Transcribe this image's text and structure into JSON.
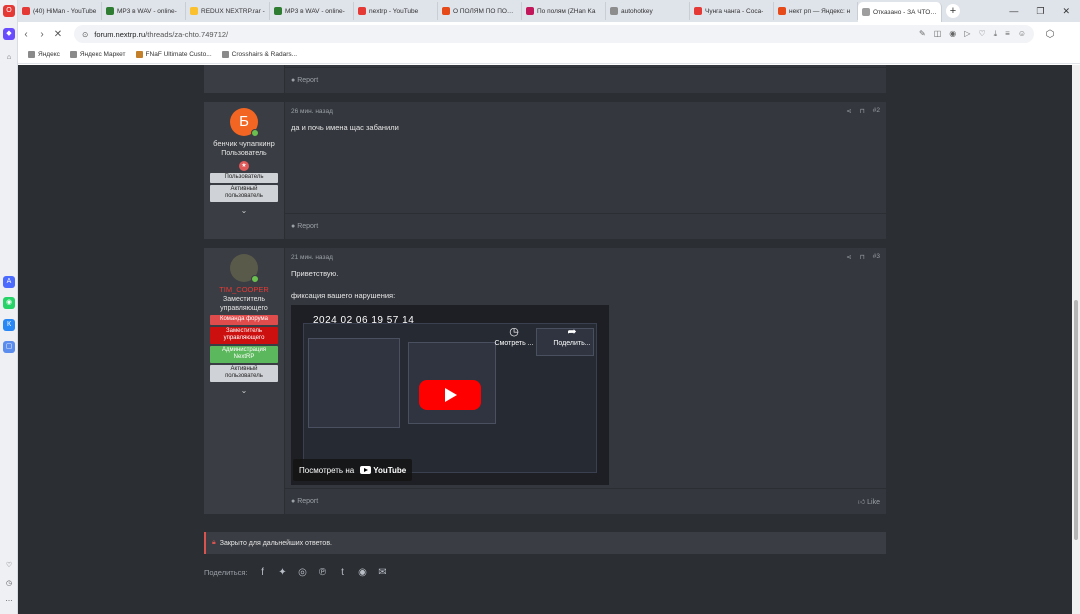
{
  "browser": {
    "tabs": [
      {
        "label": "(40) HiMan - YouTube",
        "color": "#e53935",
        "active": false
      },
      {
        "label": "MP3 в WAV - online-",
        "color": "#2e7d32",
        "active": false
      },
      {
        "label": "REDUX NEXTRP.rar -",
        "color": "#fbc02d",
        "active": false
      },
      {
        "label": "MP3 в WAV - online-",
        "color": "#2e7d32",
        "active": false
      },
      {
        "label": "nextrp - YouTube",
        "color": "#e53935",
        "active": false
      },
      {
        "label": "О ПОЛЯМ ПО ПОЛЯМ",
        "color": "#e64a19",
        "active": false
      },
      {
        "label": "По полям (ZHan Ka",
        "color": "#c2185b",
        "active": false
      },
      {
        "label": "autohotkey",
        "color": "#8d8d8d",
        "active": false
      },
      {
        "label": "Чунга чанга - Coca-",
        "color": "#e53935",
        "active": false
      },
      {
        "label": "нект рп — Яндекс: н",
        "color": "#e64a19",
        "active": false
      },
      {
        "label": "Отказано - ЗА ЧТО | NEX",
        "color": "#9e9e9e",
        "active": true
      }
    ],
    "new_tab": "+",
    "url_host": "forum.nextrp.ru",
    "url_path": "/threads/za-chto.749712/",
    "bookmarks": [
      "Яндекс",
      "Яндекс Маркет",
      "FNaF Ultimate Custo...",
      "Crosshairs & Radars..."
    ]
  },
  "posts": [
    {
      "footer_report": "Report"
    },
    {
      "avatar_letter": "Б",
      "avatar_color": "#f26522",
      "username": "бенчик чупапкинр",
      "user_title": "Пользователь",
      "banners": [
        "Пользователь",
        "Активный пользователь"
      ],
      "time": "26 мин. назад",
      "number": "#2",
      "text": "да и почь имена щас забанили",
      "footer_report": "Report"
    },
    {
      "username": "TIM_COOPER",
      "user_title": "Заместитель управляющего",
      "banners": [
        "Команда форума",
        "Заместитель управляющего",
        "Администрация NextRP",
        "Активный пользователь"
      ],
      "time": "21 мин. назад",
      "number": "#3",
      "greeting": "Приветствую.",
      "evidence_label": "фиксация вашего нарушения:",
      "video": {
        "date_overlay": "2024 02 06 19 57 14",
        "watch_later": "Смотреть ...",
        "share": "Поделить...",
        "watch_on": "Посмотреть на",
        "youtube": "YouTube"
      },
      "footer_report": "Report",
      "footer_like": "Like"
    }
  ],
  "closed_notice": "Закрыто для дальнейших ответов.",
  "share_label": "Поделиться:"
}
